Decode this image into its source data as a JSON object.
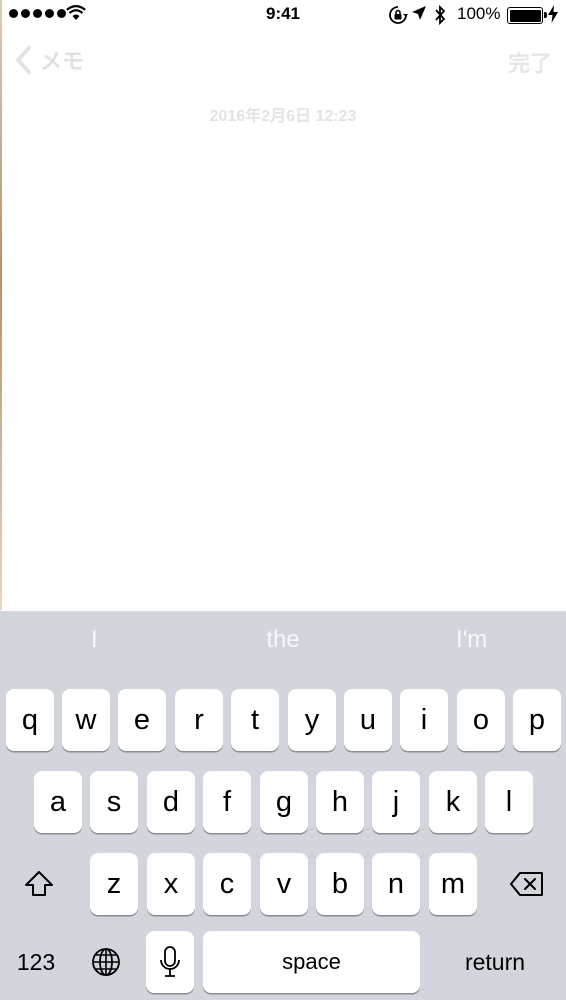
{
  "status_bar": {
    "time": "9:41",
    "battery_percent": "100%",
    "signal_dots": 5
  },
  "nav": {
    "back_label": "メモ",
    "done_label": "完了"
  },
  "note": {
    "date": "2016年2月6日 12:23",
    "body": ""
  },
  "keyboard": {
    "suggestions": [
      "I",
      "the",
      "I'm"
    ],
    "row1": [
      "q",
      "w",
      "e",
      "r",
      "t",
      "y",
      "u",
      "i",
      "o",
      "p"
    ],
    "row2": [
      "a",
      "s",
      "d",
      "f",
      "g",
      "h",
      "j",
      "k",
      "l"
    ],
    "row3": [
      "z",
      "x",
      "c",
      "v",
      "b",
      "n",
      "m"
    ],
    "numbers_label": "123",
    "space_label": "space",
    "return_label": "return"
  },
  "icons": {
    "wifi": "wifi-icon",
    "rotation_lock": "rotation-lock-icon",
    "location": "location-icon",
    "bluetooth": "bluetooth-icon",
    "battery": "battery-icon",
    "charging": "charging-icon",
    "back": "chevron-left-icon",
    "shift": "shift-icon",
    "delete": "delete-icon",
    "globe": "globe-icon",
    "microphone": "microphone-icon"
  }
}
